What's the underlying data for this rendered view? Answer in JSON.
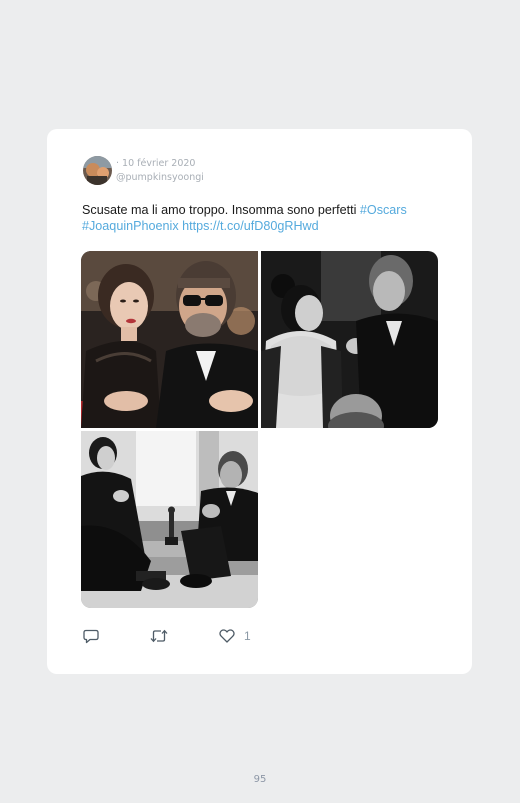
{
  "tweet": {
    "date": "· 10 février 2020",
    "handle": "@pumpkinsyoongi",
    "text": "Scusate ma li amo troppo. Insomma sono perfetti ",
    "hashtag_1": "#Oscars",
    "hashtag_2": "#JoaquinPhoenix",
    "link": "https://t.co/ufD80gRHwd",
    "photos": [
      {
        "icon": "photo-couple-red-carpet"
      },
      {
        "icon": "photo-couple-bw-backstage"
      },
      {
        "icon": "photo-couple-bw-steps-oscar"
      }
    ]
  },
  "actions": {
    "reply_icon": "reply-icon",
    "retweet_icon": "retweet-icon",
    "like_icon": "heart-icon",
    "like_count": "1"
  },
  "page": {
    "number": "95"
  },
  "colors": {
    "background": "#ecedee",
    "card": "#ffffff",
    "link": "#55aadd",
    "meta": "#a9afb6",
    "text": "#1a1a1a"
  }
}
